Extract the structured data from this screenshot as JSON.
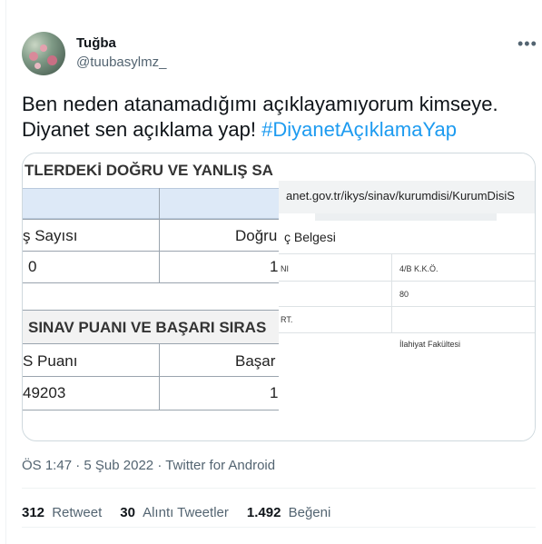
{
  "author": {
    "display_name": "Tuğba",
    "handle": "@tuubasylmz_"
  },
  "menu_icon": "more-horizontal-icon",
  "tweet": {
    "text_line1": "Ben neden atanamadığımı açıklayamıyorum kimseye.",
    "text_line2_prefix": "Diyanet sen açıklama yap! ",
    "hashtag": "#DiyanetAçıklamaYap"
  },
  "media": {
    "left": {
      "title": "TLERDEKİ DOĞRU VE YANLIŞ SA",
      "col1_header": "ş Sayısı",
      "col2_header": "Doğru",
      "col1_value": "0",
      "col2_value": "1",
      "title2": "SINAV PUANI VE BAŞARI SIRAS",
      "col1_header2": "S Puanı",
      "col2_header2": "Başar",
      "col1_value2": "49203",
      "col2_value2": "1"
    },
    "right": {
      "url": "anet.gov.tr/ikys/sinav/kurumdisi/KurumDisiS",
      "heading": "ç Belgesi",
      "r1_left": "NI",
      "r1_right": "4/B K.K.Ö.",
      "r2_right": "80",
      "r3_left": "RT.",
      "r4_right": "İlahiyat Fakültesi"
    }
  },
  "meta": {
    "time": "ÖS 1:47",
    "date": "5 Şub 2022",
    "source": "Twitter for Android",
    "separator": "·"
  },
  "stats": {
    "retweets": "312",
    "retweets_label": "Retweet",
    "quotes": "30",
    "quotes_label": "Alıntı Tweetler",
    "likes": "1.492",
    "likes_label": "Beğeni"
  }
}
